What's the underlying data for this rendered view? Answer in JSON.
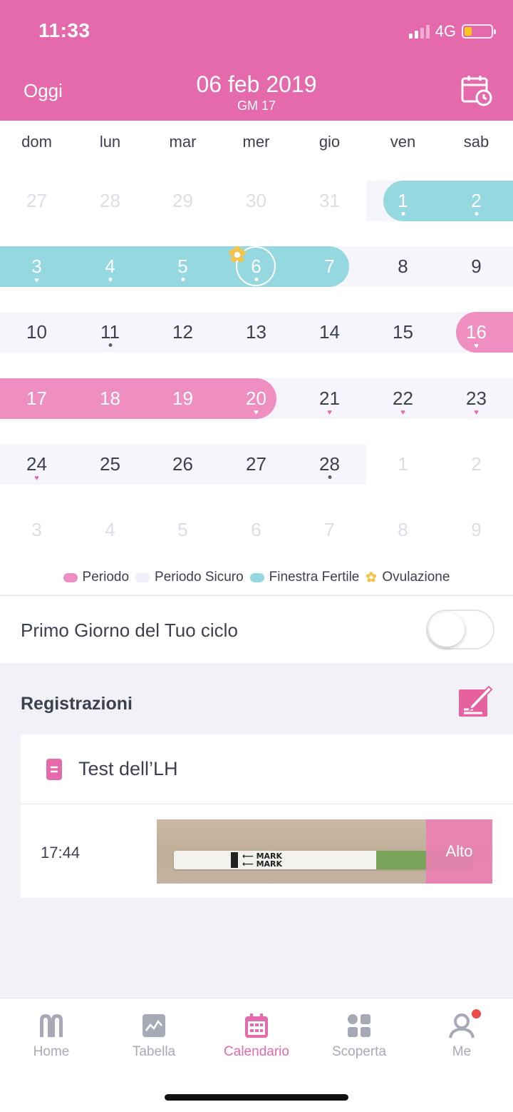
{
  "status": {
    "time": "11:33",
    "network": "4G"
  },
  "header": {
    "today_label": "Oggi",
    "date": "06 feb 2019",
    "cycle_day": "GM 17"
  },
  "weekdays": [
    "dom",
    "lun",
    "mar",
    "mer",
    "gio",
    "ven",
    "sab"
  ],
  "weeks": [
    [
      "27",
      "28",
      "29",
      "30",
      "31",
      "1",
      "2"
    ],
    [
      "3",
      "4",
      "5",
      "6",
      "7",
      "8",
      "9"
    ],
    [
      "10",
      "11",
      "12",
      "13",
      "14",
      "15",
      "16"
    ],
    [
      "17",
      "18",
      "19",
      "20",
      "21",
      "22",
      "23"
    ],
    [
      "24",
      "25",
      "26",
      "27",
      "28",
      "1",
      "2"
    ],
    [
      "3",
      "4",
      "5",
      "6",
      "7",
      "8",
      "9"
    ]
  ],
  "legend": {
    "period": "Periodo",
    "safe": "Periodo Sicuro",
    "fertile": "Finestra Fertile",
    "ovulation": "Ovulazione"
  },
  "colors": {
    "brand": "#e46aab",
    "period": "#ef8fc1",
    "fertile": "#96d8e0",
    "safe": "#f6f5fb",
    "ovulation": "#f5c24a"
  },
  "first_day": {
    "label": "Primo Giorno del Tuo ciclo"
  },
  "records": {
    "title": "Registrazioni",
    "card_title": "Test dell’LH",
    "time": "17:44",
    "result": "Alto"
  },
  "tabs": [
    {
      "label": "Home"
    },
    {
      "label": "Tabella"
    },
    {
      "label": "Calendario"
    },
    {
      "label": "Scoperta"
    },
    {
      "label": "Me"
    }
  ]
}
